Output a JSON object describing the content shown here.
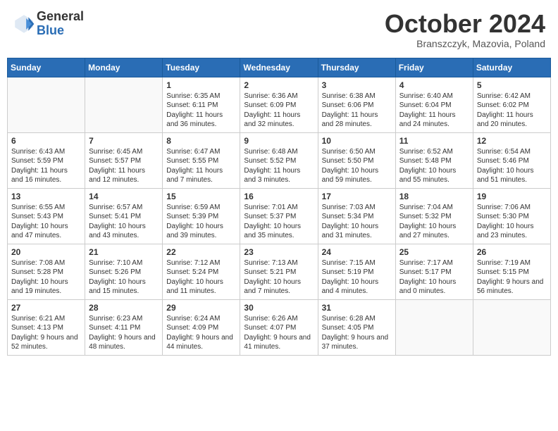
{
  "header": {
    "logo_line1": "General",
    "logo_line2": "Blue",
    "month_title": "October 2024",
    "location": "Branszczyk, Mazovia, Poland"
  },
  "weekdays": [
    "Sunday",
    "Monday",
    "Tuesday",
    "Wednesday",
    "Thursday",
    "Friday",
    "Saturday"
  ],
  "weeks": [
    [
      {
        "day": "",
        "info": ""
      },
      {
        "day": "",
        "info": ""
      },
      {
        "day": "1",
        "info": "Sunrise: 6:35 AM\nSunset: 6:11 PM\nDaylight: 11 hours and 36 minutes."
      },
      {
        "day": "2",
        "info": "Sunrise: 6:36 AM\nSunset: 6:09 PM\nDaylight: 11 hours and 32 minutes."
      },
      {
        "day": "3",
        "info": "Sunrise: 6:38 AM\nSunset: 6:06 PM\nDaylight: 11 hours and 28 minutes."
      },
      {
        "day": "4",
        "info": "Sunrise: 6:40 AM\nSunset: 6:04 PM\nDaylight: 11 hours and 24 minutes."
      },
      {
        "day": "5",
        "info": "Sunrise: 6:42 AM\nSunset: 6:02 PM\nDaylight: 11 hours and 20 minutes."
      }
    ],
    [
      {
        "day": "6",
        "info": "Sunrise: 6:43 AM\nSunset: 5:59 PM\nDaylight: 11 hours and 16 minutes."
      },
      {
        "day": "7",
        "info": "Sunrise: 6:45 AM\nSunset: 5:57 PM\nDaylight: 11 hours and 12 minutes."
      },
      {
        "day": "8",
        "info": "Sunrise: 6:47 AM\nSunset: 5:55 PM\nDaylight: 11 hours and 7 minutes."
      },
      {
        "day": "9",
        "info": "Sunrise: 6:48 AM\nSunset: 5:52 PM\nDaylight: 11 hours and 3 minutes."
      },
      {
        "day": "10",
        "info": "Sunrise: 6:50 AM\nSunset: 5:50 PM\nDaylight: 10 hours and 59 minutes."
      },
      {
        "day": "11",
        "info": "Sunrise: 6:52 AM\nSunset: 5:48 PM\nDaylight: 10 hours and 55 minutes."
      },
      {
        "day": "12",
        "info": "Sunrise: 6:54 AM\nSunset: 5:46 PM\nDaylight: 10 hours and 51 minutes."
      }
    ],
    [
      {
        "day": "13",
        "info": "Sunrise: 6:55 AM\nSunset: 5:43 PM\nDaylight: 10 hours and 47 minutes."
      },
      {
        "day": "14",
        "info": "Sunrise: 6:57 AM\nSunset: 5:41 PM\nDaylight: 10 hours and 43 minutes."
      },
      {
        "day": "15",
        "info": "Sunrise: 6:59 AM\nSunset: 5:39 PM\nDaylight: 10 hours and 39 minutes."
      },
      {
        "day": "16",
        "info": "Sunrise: 7:01 AM\nSunset: 5:37 PM\nDaylight: 10 hours and 35 minutes."
      },
      {
        "day": "17",
        "info": "Sunrise: 7:03 AM\nSunset: 5:34 PM\nDaylight: 10 hours and 31 minutes."
      },
      {
        "day": "18",
        "info": "Sunrise: 7:04 AM\nSunset: 5:32 PM\nDaylight: 10 hours and 27 minutes."
      },
      {
        "day": "19",
        "info": "Sunrise: 7:06 AM\nSunset: 5:30 PM\nDaylight: 10 hours and 23 minutes."
      }
    ],
    [
      {
        "day": "20",
        "info": "Sunrise: 7:08 AM\nSunset: 5:28 PM\nDaylight: 10 hours and 19 minutes."
      },
      {
        "day": "21",
        "info": "Sunrise: 7:10 AM\nSunset: 5:26 PM\nDaylight: 10 hours and 15 minutes."
      },
      {
        "day": "22",
        "info": "Sunrise: 7:12 AM\nSunset: 5:24 PM\nDaylight: 10 hours and 11 minutes."
      },
      {
        "day": "23",
        "info": "Sunrise: 7:13 AM\nSunset: 5:21 PM\nDaylight: 10 hours and 7 minutes."
      },
      {
        "day": "24",
        "info": "Sunrise: 7:15 AM\nSunset: 5:19 PM\nDaylight: 10 hours and 4 minutes."
      },
      {
        "day": "25",
        "info": "Sunrise: 7:17 AM\nSunset: 5:17 PM\nDaylight: 10 hours and 0 minutes."
      },
      {
        "day": "26",
        "info": "Sunrise: 7:19 AM\nSunset: 5:15 PM\nDaylight: 9 hours and 56 minutes."
      }
    ],
    [
      {
        "day": "27",
        "info": "Sunrise: 6:21 AM\nSunset: 4:13 PM\nDaylight: 9 hours and 52 minutes."
      },
      {
        "day": "28",
        "info": "Sunrise: 6:23 AM\nSunset: 4:11 PM\nDaylight: 9 hours and 48 minutes."
      },
      {
        "day": "29",
        "info": "Sunrise: 6:24 AM\nSunset: 4:09 PM\nDaylight: 9 hours and 44 minutes."
      },
      {
        "day": "30",
        "info": "Sunrise: 6:26 AM\nSunset: 4:07 PM\nDaylight: 9 hours and 41 minutes."
      },
      {
        "day": "31",
        "info": "Sunrise: 6:28 AM\nSunset: 4:05 PM\nDaylight: 9 hours and 37 minutes."
      },
      {
        "day": "",
        "info": ""
      },
      {
        "day": "",
        "info": ""
      }
    ]
  ]
}
